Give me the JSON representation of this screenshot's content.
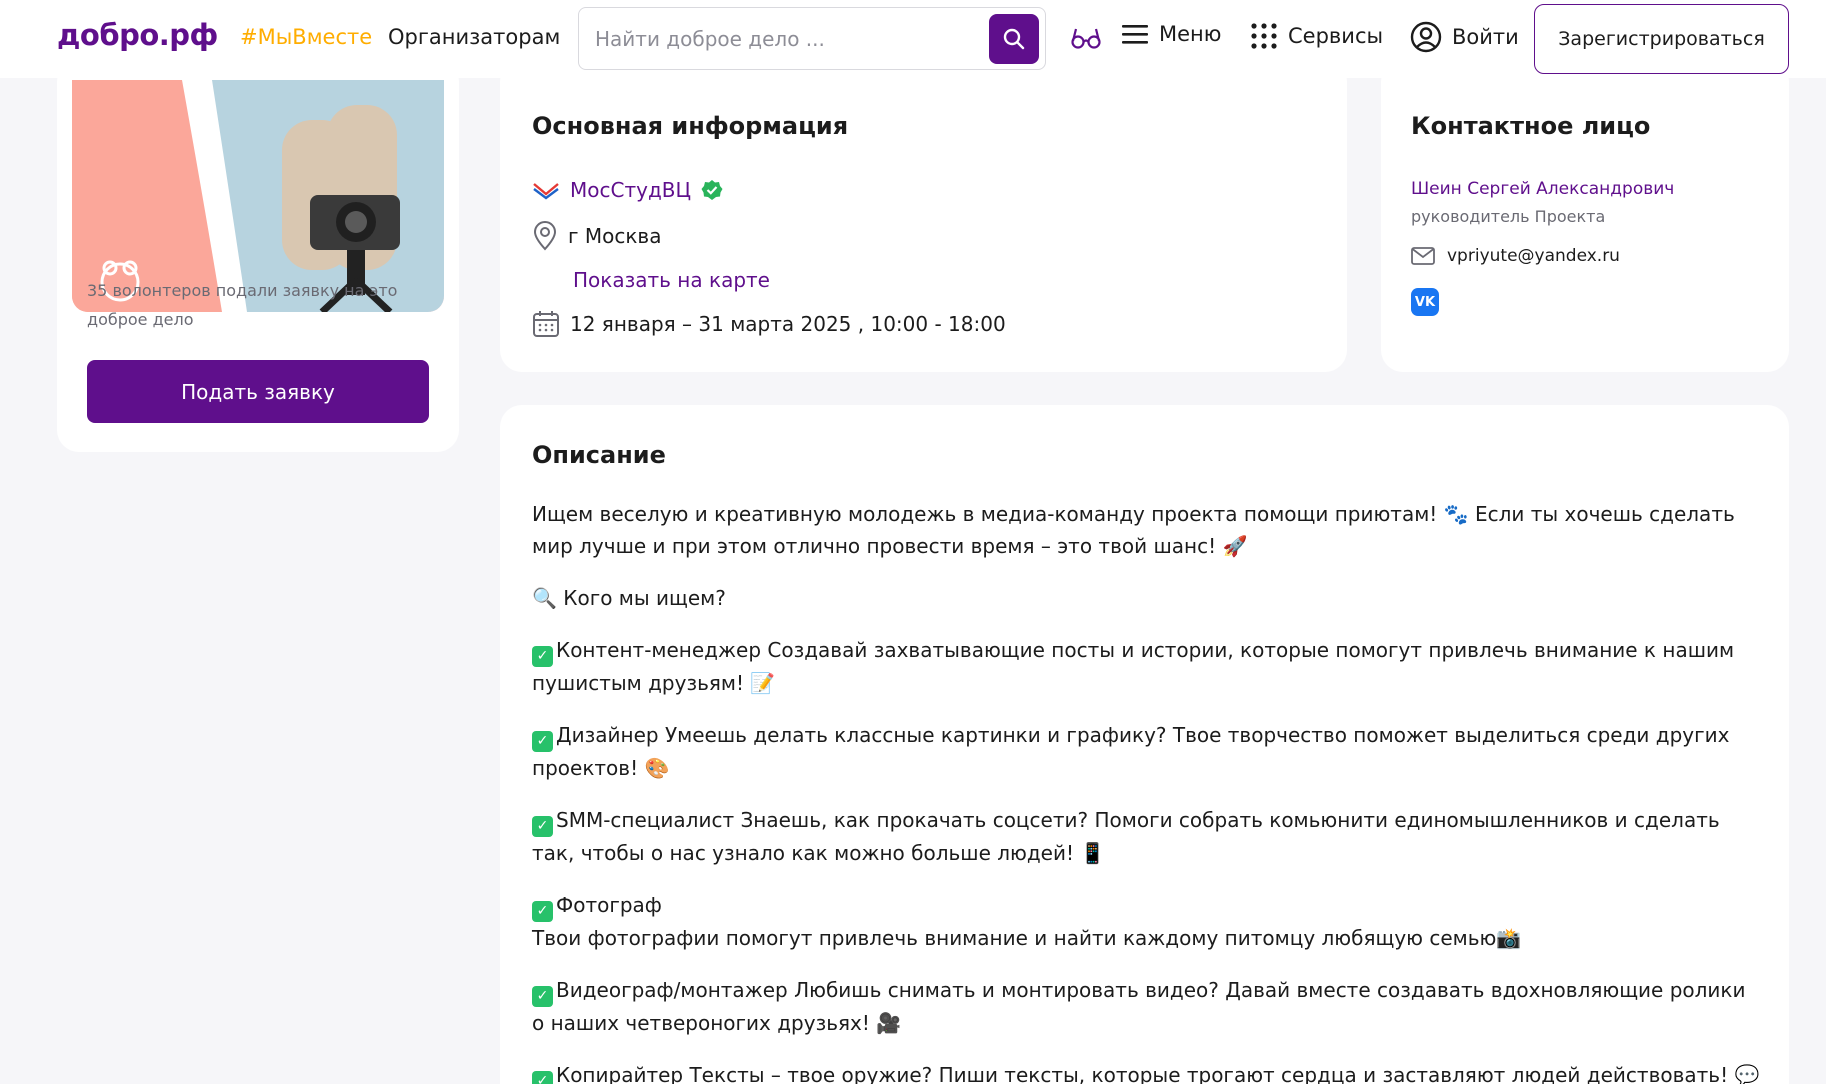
{
  "header": {
    "logo": "добро.рф",
    "hashtag": "#МыВместе",
    "organizers": "Организаторам",
    "search_placeholder": "Найти доброе дело ...",
    "menu": "Меню",
    "services": "Сервисы",
    "login": "Войти",
    "register": "Зарегистрироваться"
  },
  "sidebar": {
    "volunteers_text": "35 волонтеров подали заявку на это доброе дело",
    "apply_button": "Подать заявку"
  },
  "info": {
    "title": "Основная информация",
    "organization": "МосСтудВЦ",
    "city": "г Москва",
    "map_link": "Показать на карте",
    "dates": "12 января – 31 марта 2025 , 10:00 - 18:00"
  },
  "contact": {
    "title": "Контактное лицо",
    "name": "Шеин Сергей Александрович",
    "role": "руководитель Проекта",
    "email": "vpriyute@yandex.ru"
  },
  "description": {
    "title": "Описание",
    "intro": "Ищем веселую и креативную молодежь в медиа-команду проекта помощи приютам! 🐾 Если ты хочешь сделать мир лучше и при этом отлично провести время – это твой шанс! 🚀",
    "who": "🔍 Кого мы ищем?",
    "roles": [
      "Контент-менеджер Создавай захватывающие посты и истории, которые помогут привлечь внимание к нашим пушистым друзьям! 📝",
      "Дизайнер Умеешь делать классные картинки и графику? Твое творчество поможет выделиться среди других проектов! 🎨",
      "SMM-специалист Знаешь, как прокачать соцсети? Помоги собрать комьюнити единомышленников и сделать так, чтобы о нас узнало как можно больше людей! 📱",
      "Фотограф",
      "Видеограф/монтажер Любишь снимать и монтировать видео? Давай вместе создавать вдохновляющие ролики о наших четвероногих друзьях! 🎥",
      "Копирайтер Тексты – твое оружие? Пиши тексты, которые трогают сердца и заставляют людей действовать! 💬"
    ],
    "photographer_detail": "Твои фотографии помогут привлечь внимание и найти каждому питомцу любящую семью📸"
  },
  "colors": {
    "brand": "#5f0f8c",
    "accent": "#ffad00",
    "check": "#27c16a",
    "verified": "#2ab45b"
  }
}
